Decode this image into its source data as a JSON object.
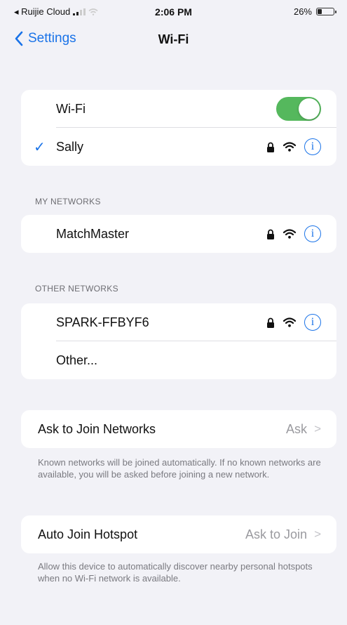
{
  "status_bar": {
    "carrier": "◂ Ruijie Cloud",
    "time": "2:06 PM",
    "battery_text": "26%",
    "battery_level": 0.26
  },
  "nav": {
    "back_label": "Settings",
    "title": "Wi-Fi"
  },
  "wifi_group": {
    "toggle_label": "Wi-Fi",
    "toggle_on": true,
    "connected_network": "Sally",
    "check": "✓"
  },
  "my_networks": {
    "header": "MY NETWORKS",
    "items": [
      {
        "name": "MatchMaster"
      }
    ]
  },
  "other_networks": {
    "header": "OTHER NETWORKS",
    "items": [
      {
        "name": "SPARK-FFBYF6"
      }
    ],
    "other_label": "Other..."
  },
  "ask_to_join": {
    "label": "Ask to Join Networks",
    "value": "Ask",
    "footnote": "Known networks will be joined automatically. If no known networks are available, you will be asked before joining a new network."
  },
  "auto_join_hotspot": {
    "label": "Auto Join Hotspot",
    "value": "Ask to Join",
    "footnote": "Allow this device to automatically discover nearby personal hotspots when no Wi-Fi network is available."
  },
  "icons": {
    "info": "i",
    "chevron": ">"
  },
  "colors": {
    "accent": "#1a73e8",
    "toggle_on": "#55b85d",
    "background": "#f2f2f7"
  }
}
